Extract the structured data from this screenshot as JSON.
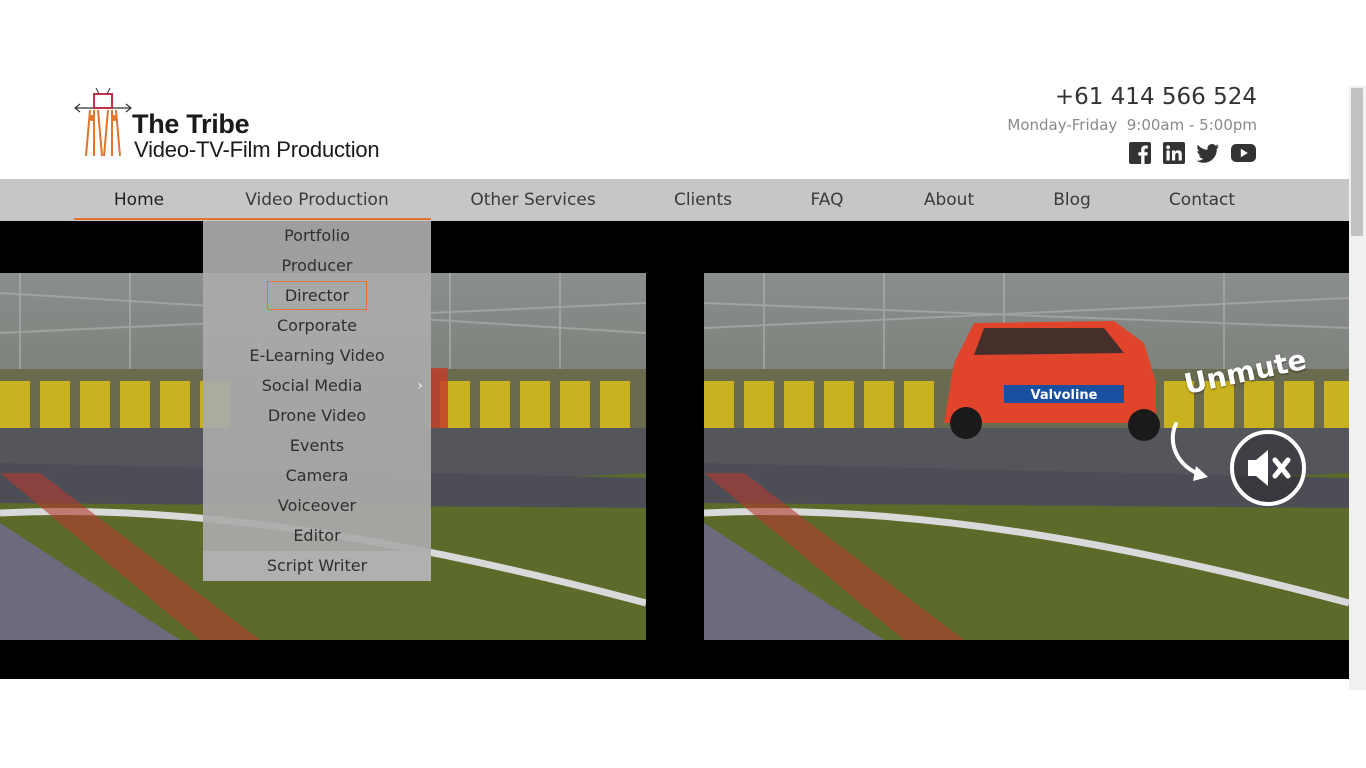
{
  "brand": {
    "title": "The Tribe",
    "subtitle": "Video-TV-Film Production"
  },
  "contact": {
    "phone": "+61 414 566 524",
    "hours": "Monday-Friday  9:00am - 5:00pm"
  },
  "social": [
    {
      "icon": "facebook-icon"
    },
    {
      "icon": "linkedin-icon"
    },
    {
      "icon": "twitter-icon"
    },
    {
      "icon": "youtube-icon"
    }
  ],
  "nav": {
    "items": [
      {
        "label": "Home"
      },
      {
        "label": "Video Production"
      },
      {
        "label": "Other Services"
      },
      {
        "label": "Clients"
      },
      {
        "label": "FAQ"
      },
      {
        "label": "About"
      },
      {
        "label": "Blog"
      },
      {
        "label": "Contact"
      }
    ],
    "active": "Home"
  },
  "dropdown": {
    "items": [
      {
        "label": "Portfolio"
      },
      {
        "label": "Producer"
      },
      {
        "label": "Director"
      },
      {
        "label": "Corporate"
      },
      {
        "label": "E-Learning Video"
      },
      {
        "label": "Social Media"
      },
      {
        "label": "Drone Video"
      },
      {
        "label": "Events"
      },
      {
        "label": "Camera"
      },
      {
        "label": "Voiceover"
      },
      {
        "label": "Editor"
      },
      {
        "label": "Script Writer"
      }
    ],
    "focused": "Director"
  },
  "video": {
    "unmute_label": "Unmute",
    "car_livery": "Valvoline"
  },
  "colors": {
    "accent": "#e2742f",
    "nav_bg": "#c6c6c6",
    "dropdown_bg": "#aaaaaa"
  }
}
